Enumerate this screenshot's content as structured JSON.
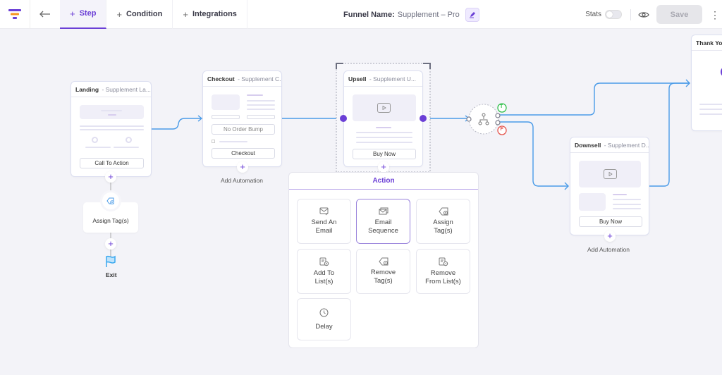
{
  "header": {
    "logo_icon": "funnel-logo-icon",
    "back_icon": "arrow-left-icon",
    "tabs": [
      {
        "label": "Step",
        "active": true
      },
      {
        "label": "Condition",
        "active": false
      },
      {
        "label": "Integrations",
        "active": false
      }
    ],
    "funnel_name_label": "Funnel Name:",
    "funnel_name_value": "Supplement – Pro",
    "stats_label": "Stats",
    "stats_enabled": false,
    "save_label": "Save",
    "more_icon": "⋮"
  },
  "colors": {
    "accent": "#6b3fd6",
    "connector": "#4a9be8",
    "true_badge": "#2fbf4a",
    "false_badge": "#e5534b",
    "annotation_arrow": "#f7941d"
  },
  "nodes": {
    "landing": {
      "type": "Landing",
      "name": "- Supplement La...",
      "button": "Call To Action"
    },
    "checkout": {
      "type": "Checkout",
      "name": "- Supplement C...",
      "order_bump": "No Order Bump",
      "button": "Checkout",
      "add_automation": "Add Automation"
    },
    "upsell": {
      "type": "Upsell",
      "name": "- Supplement U...",
      "button": "Buy Now"
    },
    "downsell": {
      "type": "Downsell",
      "name": "- Supplement D...",
      "button": "Buy Now",
      "add_automation": "Add Automation"
    },
    "thankyou": {
      "type": "Thank You",
      "name": ""
    },
    "condition": {
      "true_label": "T",
      "false_label": "F"
    }
  },
  "landing_automation": {
    "step_label": "Assign Tag(s)",
    "exit_label": "Exit"
  },
  "action_panel": {
    "title": "Action",
    "items": [
      {
        "label_1": "Send An",
        "label_2": "Email",
        "icon": "send-email-icon",
        "selected": false
      },
      {
        "label_1": "Email",
        "label_2": "Sequence",
        "icon": "email-sequence-icon",
        "selected": true
      },
      {
        "label_1": "Assign",
        "label_2": "Tag(s)",
        "icon": "assign-tag-icon",
        "selected": false
      },
      {
        "label_1": "Add To",
        "label_2": "List(s)",
        "icon": "add-list-icon",
        "selected": false
      },
      {
        "label_1": "Remove",
        "label_2": "Tag(s)",
        "icon": "remove-tag-icon",
        "selected": false
      },
      {
        "label_1": "Remove",
        "label_2": "From List(s)",
        "icon": "remove-list-icon",
        "selected": false
      },
      {
        "label_1": "Delay",
        "label_2": "",
        "icon": "clock-icon",
        "selected": false
      }
    ]
  }
}
